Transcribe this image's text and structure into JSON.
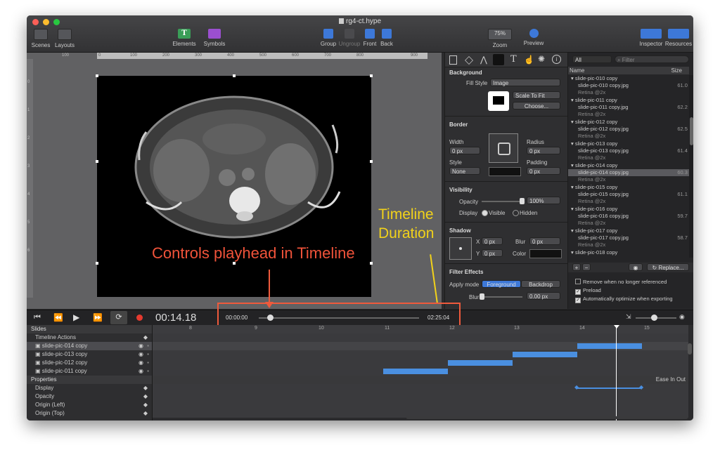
{
  "window": {
    "title": "rg4-ct.hype"
  },
  "toolbar": {
    "scenes": "Scenes",
    "layouts": "Layouts",
    "elements": "Elements",
    "symbols": "Symbols",
    "group": "Group",
    "ungroup": "Ungroup",
    "front": "Front",
    "back": "Back",
    "zoom_value": "75%",
    "zoom": "Zoom",
    "preview": "Preview",
    "inspector": "Inspector",
    "resources": "Resources"
  },
  "rulers": {
    "h": [
      "100",
      "0",
      "100",
      "200",
      "300",
      "400",
      "500",
      "600",
      "700",
      "800",
      "900"
    ],
    "v": [
      "0",
      "1",
      "2",
      "3",
      "4",
      "5",
      "6"
    ]
  },
  "annotations": {
    "playhead": "Controls playhead in Timeline",
    "duration_line1": "Timeline",
    "duration_line2": "Duration"
  },
  "inspector": {
    "background": "Background",
    "fill_style_label": "Fill Style",
    "fill_style": "Image",
    "scale": "Scale To Fit",
    "choose": "Choose...",
    "border": "Border",
    "width": "Width",
    "width_val": "0 px",
    "radius": "Radius",
    "radius_val": "0 px",
    "style": "Style",
    "style_val": "None",
    "padding": "Padding",
    "padding_val": "0 px",
    "visibility": "Visibility",
    "opacity": "Opacity",
    "opacity_val": "100%",
    "display": "Display",
    "visible": "Visible",
    "hidden": "Hidden",
    "shadow": "Shadow",
    "x": "X",
    "x_val": "0 px",
    "y": "Y",
    "y_val": "0 px",
    "blur": "Blur",
    "blur_val": "0 px",
    "color": "Color",
    "filter_effects": "Filter Effects",
    "apply_mode": "Apply mode",
    "foreground": "Foreground",
    "backdrop": "Backdrop",
    "blur2": "Blur",
    "blur2_val": "0.00 px"
  },
  "resources": {
    "filter_scope": "All",
    "filter_placeholder": "Filter",
    "col_name": "Name",
    "col_size": "Size",
    "rows": [
      {
        "label": "slide-pic-010 copy",
        "size": ""
      },
      {
        "label": "slide-pic-010 copy.jpg",
        "size": "61.0 KB"
      },
      {
        "label": "Retina @2x",
        "size": ""
      },
      {
        "label": "slide-pic-011 copy",
        "size": ""
      },
      {
        "label": "slide-pic-011 copy.jpg",
        "size": "62.2 KB"
      },
      {
        "label": "Retina @2x",
        "size": ""
      },
      {
        "label": "slide-pic-012 copy",
        "size": ""
      },
      {
        "label": "slide-pic-012 copy.jpg",
        "size": "62.5 KB"
      },
      {
        "label": "Retina @2x",
        "size": ""
      },
      {
        "label": "slide-pic-013 copy",
        "size": ""
      },
      {
        "label": "slide-pic-013 copy.jpg",
        "size": "61.4 KB"
      },
      {
        "label": "Retina @2x",
        "size": ""
      },
      {
        "label": "slide-pic-014 copy",
        "size": ""
      },
      {
        "label": "slide-pic-014 copy.jpg",
        "size": "60.3 KB"
      },
      {
        "label": "Retina @2x",
        "size": ""
      },
      {
        "label": "slide-pic-015 copy",
        "size": ""
      },
      {
        "label": "slide-pic-015 copy.jpg",
        "size": "61.1 KB"
      },
      {
        "label": "Retina @2x",
        "size": ""
      },
      {
        "label": "slide-pic-016 copy",
        "size": ""
      },
      {
        "label": "slide-pic-016 copy.jpg",
        "size": "59.7 KB"
      },
      {
        "label": "Retina @2x",
        "size": ""
      },
      {
        "label": "slide-pic-017 copy",
        "size": ""
      },
      {
        "label": "slide-pic-017 copy.jpg",
        "size": "58.7 KB"
      },
      {
        "label": "Retina @2x",
        "size": ""
      },
      {
        "label": "slide-pic-018 copy",
        "size": ""
      }
    ],
    "replace": "Replace...",
    "opt_remove": "Remove when no longer referenced",
    "opt_preload": "Preload",
    "opt_optimize": "Automatically optimize when exporting"
  },
  "timeline": {
    "time": "00:14.18",
    "scrub_start": "00:00:00",
    "scrub_end": "02:25:04",
    "ticks": [
      "8",
      "9",
      "10",
      "11",
      "12",
      "13",
      "14",
      "15"
    ],
    "slides": "Slides",
    "timeline_actions": "Timeline Actions",
    "layers": [
      "slide-pic-014 copy",
      "slide-pic-013 copy",
      "slide-pic-012 copy",
      "slide-pic-011 copy"
    ],
    "properties": "Properties",
    "easing": "Ease In Out",
    "props": [
      "Display",
      "Opacity",
      "Origin (Left)",
      "Origin (Top)"
    ]
  }
}
